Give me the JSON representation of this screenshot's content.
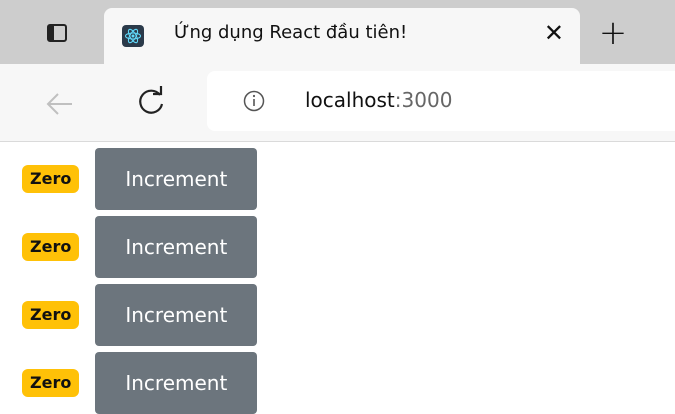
{
  "browser": {
    "tab": {
      "title": "Ứng dụng React đầu tiên!",
      "close_glyph": "✕",
      "favicon": "react-logo-icon"
    },
    "new_tab_glyph": "+",
    "address": {
      "host": "localhost",
      "port": ":3000"
    },
    "icons": {
      "tab_actions": "tab-actions-icon",
      "back": "back-arrow-icon",
      "reload": "reload-icon",
      "info": "info-icon"
    }
  },
  "counters": [
    {
      "badge": "Zero",
      "button": "Increment"
    },
    {
      "badge": "Zero",
      "button": "Increment"
    },
    {
      "badge": "Zero",
      "button": "Increment"
    },
    {
      "badge": "Zero",
      "button": "Increment"
    }
  ],
  "colors": {
    "badge_bg": "#ffc107",
    "button_bg": "#6c757d"
  }
}
